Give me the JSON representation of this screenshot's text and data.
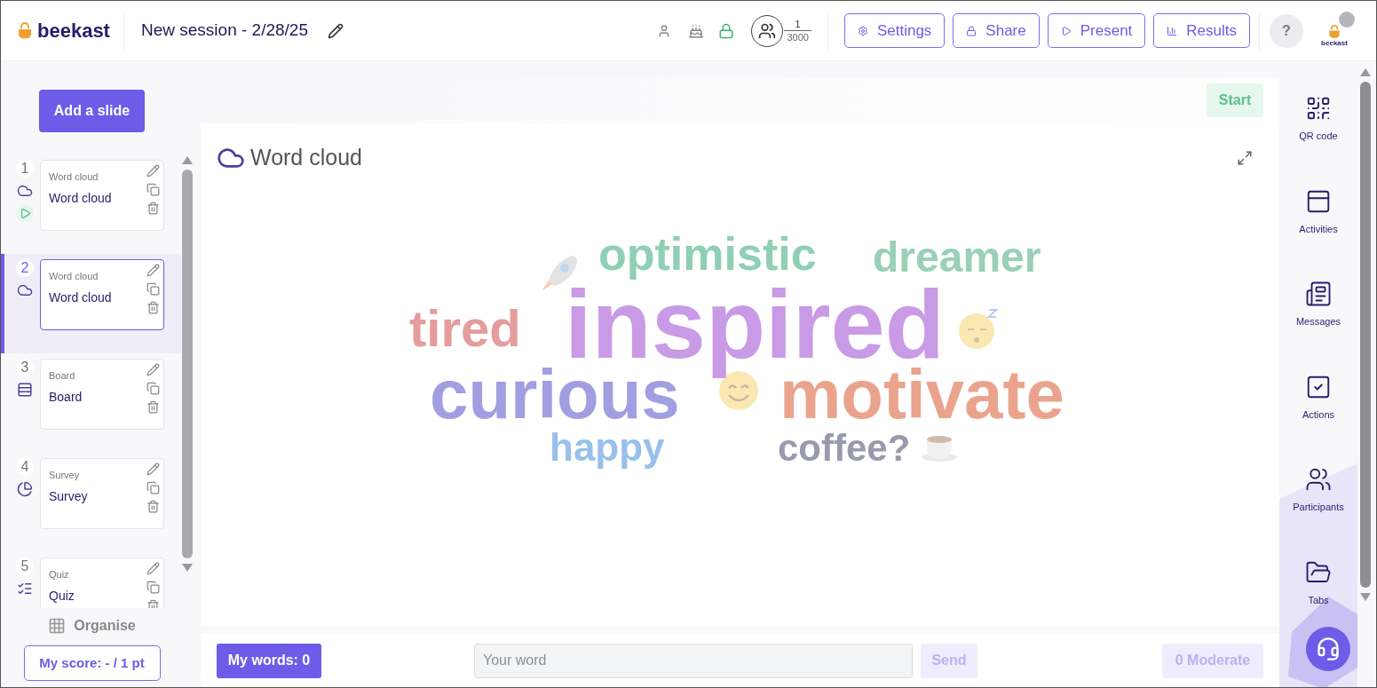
{
  "header": {
    "logo": "beekast",
    "session_title": "New session - 2/28/25",
    "participants": {
      "count": "1",
      "max": "3000"
    },
    "buttons": [
      "Settings",
      "Share",
      "Present",
      "Results"
    ],
    "help": "?",
    "account_logo": "beekast"
  },
  "sidebar": {
    "add_button": "Add a slide",
    "slides": [
      {
        "number": "1",
        "type": "Word cloud",
        "title": "Word cloud",
        "kind": "wordcloud",
        "live": true,
        "selected": false
      },
      {
        "number": "2",
        "type": "Word cloud",
        "title": "Word cloud",
        "kind": "wordcloud",
        "live": false,
        "selected": true
      },
      {
        "number": "3",
        "type": "Board",
        "title": "Board",
        "kind": "board",
        "live": false,
        "selected": false
      },
      {
        "number": "4",
        "type": "Survey",
        "title": "Survey",
        "kind": "survey",
        "live": false,
        "selected": false
      },
      {
        "number": "5",
        "type": "Quiz",
        "title": "Quiz",
        "kind": "quiz",
        "live": false,
        "selected": false
      }
    ],
    "organise": "Organise",
    "score_button": "My score: - / 1 pt"
  },
  "slide": {
    "start_button": "Start",
    "title": "Word cloud",
    "words": [
      {
        "text": "optimistic",
        "color": "#8fcfb6"
      },
      {
        "text": "dreamer",
        "color": "#9acfb8"
      },
      {
        "text": "tired",
        "color": "#e49c9c"
      },
      {
        "text": "inspired",
        "color": "#c99ae6"
      },
      {
        "text": "curious",
        "color": "#a19ee2"
      },
      {
        "text": "motivate",
        "color": "#eaa48e"
      },
      {
        "text": "happy",
        "color": "#98c0ea"
      },
      {
        "text": "coffee?",
        "color": "#9a9aae"
      }
    ],
    "my_words_button": "My words: 0",
    "word_input": {
      "placeholder": "Your word"
    },
    "send_button": "Send",
    "moderate_button": "0 Moderate"
  },
  "right_rail": [
    "QR code",
    "Activities",
    "Messages",
    "Actions",
    "Participants",
    "Tabs"
  ]
}
